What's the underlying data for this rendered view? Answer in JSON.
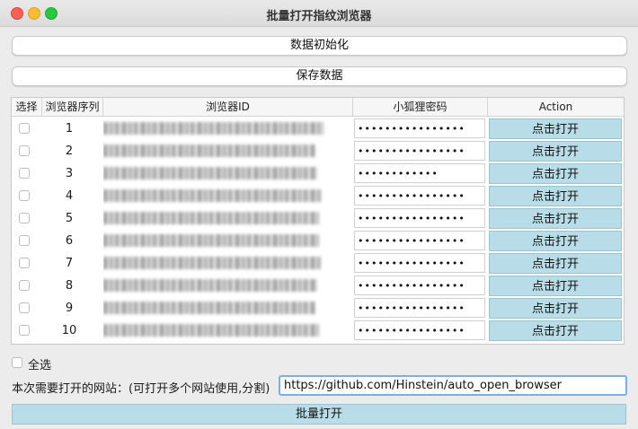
{
  "window": {
    "title": "批量打开指纹浏览器"
  },
  "buttons": {
    "init_label": "数据初始化",
    "save_label": "保存数据",
    "bulk_open_label": "批量打开"
  },
  "table": {
    "headers": [
      "选择",
      "浏览器序列",
      "浏览器ID",
      "小狐狸密码",
      "Action"
    ],
    "rows": [
      {
        "index": "1",
        "password": "••••••••••••••••",
        "action": "点击打开"
      },
      {
        "index": "2",
        "password": "••••••••••••••••",
        "action": "点击打开"
      },
      {
        "index": "3",
        "password": "••••••••••••",
        "action": "点击打开"
      },
      {
        "index": "4",
        "password": "••••••••••••••••",
        "action": "点击打开"
      },
      {
        "index": "5",
        "password": "••••••••••••••••",
        "action": "点击打开"
      },
      {
        "index": "6",
        "password": "••••••••••••••••",
        "action": "点击打开"
      },
      {
        "index": "7",
        "password": "••••••••••••••••",
        "action": "点击打开"
      },
      {
        "index": "8",
        "password": "••••••••••••••••",
        "action": "点击打开"
      },
      {
        "index": "9",
        "password": "••••••••••••••••",
        "action": "点击打开"
      },
      {
        "index": "10",
        "password": "••••••••••••••••",
        "action": "点击打开"
      }
    ]
  },
  "select_all": {
    "label": "全选",
    "checked": false
  },
  "url": {
    "label": "本次需要打开的网站：(可打开多个网站使用,分割)",
    "value": "https://github.com/Hinstein/auto_open_browser"
  },
  "colors": {
    "action_bg": "#b9dde8",
    "input_focus": "#7aaee8"
  }
}
